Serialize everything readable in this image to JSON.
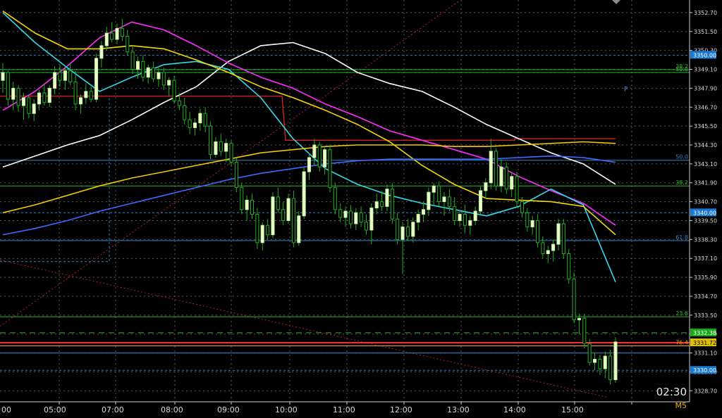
{
  "meta": {
    "timeframe": "M5",
    "countdown": "02:30"
  },
  "chart_data": {
    "type": "candlestick",
    "ylim": [
      3328.0,
      3353.5
    ],
    "y_ticks": [
      "3352.70",
      "3351.50",
      "3350.30",
      "3349.10",
      "3347.90",
      "3346.70",
      "3345.50",
      "3344.30",
      "3343.10",
      "3341.90",
      "3340.70",
      "3339.50",
      "3338.30",
      "3337.10",
      "3335.90",
      "3334.70",
      "3333.50",
      "3332.30",
      "3331.10",
      "3329.90",
      "3328.70"
    ],
    "x_labels": [
      "00",
      "05:00",
      "07:00",
      "08:00",
      "09:00",
      "10:00",
      "11:00",
      "12:00",
      "13:00",
      "14:00",
      "15:00"
    ],
    "candles": [
      [
        3348.4,
        3349.5,
        3347.6,
        3348.9
      ],
      [
        3348.9,
        3349.0,
        3346.8,
        3347.2
      ],
      [
        3347.2,
        3348.3,
        3346.5,
        3347.9
      ],
      [
        3347.9,
        3348.1,
        3346.4,
        3346.8
      ],
      [
        3346.8,
        3347.6,
        3345.9,
        3347.3
      ],
      [
        3347.3,
        3347.5,
        3346.0,
        3346.3
      ],
      [
        3346.3,
        3347.2,
        3345.8,
        3346.9
      ],
      [
        3346.9,
        3347.8,
        3346.5,
        3347.6
      ],
      [
        3347.6,
        3348.2,
        3346.8,
        3347.0
      ],
      [
        3347.0,
        3348.1,
        3346.7,
        3347.9
      ],
      [
        3347.9,
        3349.3,
        3347.5,
        3348.9
      ],
      [
        3348.9,
        3349.4,
        3348.0,
        3348.4
      ],
      [
        3348.4,
        3349.2,
        3347.8,
        3349.0
      ],
      [
        3349.0,
        3349.5,
        3348.1,
        3348.3
      ],
      [
        3348.3,
        3349.0,
        3346.5,
        3346.9
      ],
      [
        3346.9,
        3347.5,
        3346.3,
        3347.3
      ],
      [
        3347.3,
        3348.2,
        3346.9,
        3347.7
      ],
      [
        3347.7,
        3348.0,
        3347.0,
        3347.2
      ],
      [
        3347.2,
        3350.1,
        3347.0,
        3349.8
      ],
      [
        3349.8,
        3350.9,
        3349.2,
        3350.6
      ],
      [
        3350.6,
        3351.8,
        3350.3,
        3351.4
      ],
      [
        3351.4,
        3352.1,
        3350.8,
        3351.0
      ],
      [
        3351.0,
        3352.0,
        3350.7,
        3351.7
      ],
      [
        3351.7,
        3352.3,
        3350.9,
        3351.2
      ],
      [
        3351.2,
        3351.6,
        3350.0,
        3350.2
      ],
      [
        3350.2,
        3350.6,
        3348.8,
        3349.1
      ],
      [
        3349.1,
        3349.9,
        3348.5,
        3349.6
      ],
      [
        3349.6,
        3350.0,
        3348.3,
        3348.6
      ],
      [
        3348.6,
        3349.4,
        3348.2,
        3349.2
      ],
      [
        3349.2,
        3349.6,
        3348.3,
        3348.5
      ],
      [
        3348.5,
        3349.3,
        3348.0,
        3348.9
      ],
      [
        3348.9,
        3349.2,
        3347.8,
        3348.1
      ],
      [
        3348.1,
        3348.6,
        3347.4,
        3348.4
      ],
      [
        3348.4,
        3348.7,
        3346.9,
        3347.1
      ],
      [
        3347.1,
        3347.6,
        3346.5,
        3346.8
      ],
      [
        3346.8,
        3347.3,
        3345.6,
        3345.9
      ],
      [
        3345.9,
        3346.4,
        3345.0,
        3345.4
      ],
      [
        3345.4,
        3346.0,
        3344.9,
        3345.7
      ],
      [
        3345.7,
        3346.6,
        3345.2,
        3346.3
      ],
      [
        3346.3,
        3346.7,
        3345.1,
        3345.5
      ],
      [
        3345.5,
        3345.8,
        3343.4,
        3343.7
      ],
      [
        3343.7,
        3344.8,
        3343.5,
        3344.5
      ],
      [
        3344.5,
        3345.0,
        3343.6,
        3343.9
      ],
      [
        3343.9,
        3344.7,
        3343.2,
        3344.4
      ],
      [
        3344.4,
        3344.6,
        3342.9,
        3343.2
      ],
      [
        3343.2,
        3343.5,
        3341.3,
        3341.6
      ],
      [
        3341.6,
        3341.9,
        3339.9,
        3340.2
      ],
      [
        3340.2,
        3341.1,
        3339.5,
        3340.8
      ],
      [
        3340.8,
        3341.2,
        3339.6,
        3339.9
      ],
      [
        3339.9,
        3340.3,
        3337.7,
        3338.1
      ],
      [
        3338.1,
        3339.4,
        3337.6,
        3339.2
      ],
      [
        3339.2,
        3339.6,
        3338.3,
        3338.6
      ],
      [
        3338.6,
        3341.3,
        3338.4,
        3341.0
      ],
      [
        3341.0,
        3341.6,
        3340.0,
        3340.2
      ],
      [
        3340.2,
        3340.7,
        3339.2,
        3339.5
      ],
      [
        3339.5,
        3341.2,
        3339.3,
        3340.9
      ],
      [
        3340.9,
        3341.4,
        3337.8,
        3338.1
      ],
      [
        3338.1,
        3340.1,
        3337.9,
        3339.8
      ],
      [
        3339.8,
        3342.9,
        3339.6,
        3342.6
      ],
      [
        3342.6,
        3343.8,
        3342.1,
        3343.5
      ],
      [
        3343.5,
        3344.7,
        3343.0,
        3344.3
      ],
      [
        3344.3,
        3344.5,
        3342.6,
        3342.9
      ],
      [
        3342.9,
        3344.2,
        3342.4,
        3344.0
      ],
      [
        3344.0,
        3344.3,
        3341.3,
        3341.6
      ],
      [
        3341.6,
        3341.9,
        3339.9,
        3340.2
      ],
      [
        3340.2,
        3340.6,
        3339.4,
        3339.7
      ],
      [
        3339.7,
        3340.4,
        3339.1,
        3340.1
      ],
      [
        3340.1,
        3340.5,
        3339.0,
        3339.3
      ],
      [
        3339.3,
        3340.3,
        3338.9,
        3340.0
      ],
      [
        3340.0,
        3340.4,
        3339.1,
        3339.4
      ],
      [
        3339.4,
        3339.9,
        3338.6,
        3338.9
      ],
      [
        3338.9,
        3340.6,
        3338.0,
        3340.3
      ],
      [
        3340.3,
        3341.2,
        3339.9,
        3340.7
      ],
      [
        3340.7,
        3341.4,
        3340.1,
        3340.4
      ],
      [
        3340.4,
        3341.8,
        3340.1,
        3341.5
      ],
      [
        3341.5,
        3341.9,
        3339.3,
        3339.6
      ],
      [
        3339.6,
        3340.0,
        3338.0,
        3338.3
      ],
      [
        3338.3,
        3339.4,
        3336.1,
        3339.1
      ],
      [
        3339.1,
        3339.6,
        3338.2,
        3338.5
      ],
      [
        3338.5,
        3339.7,
        3338.1,
        3339.4
      ],
      [
        3339.4,
        3340.2,
        3338.9,
        3339.9
      ],
      [
        3339.9,
        3340.7,
        3339.4,
        3340.2
      ],
      [
        3340.2,
        3341.6,
        3339.8,
        3341.3
      ],
      [
        3341.3,
        3341.9,
        3340.5,
        3341.7
      ],
      [
        3341.7,
        3342.0,
        3340.4,
        3340.7
      ],
      [
        3340.7,
        3341.3,
        3339.8,
        3341.0
      ],
      [
        3341.0,
        3341.5,
        3340.1,
        3340.4
      ],
      [
        3340.4,
        3341.0,
        3339.2,
        3339.5
      ],
      [
        3339.5,
        3340.2,
        3339.1,
        3339.9
      ],
      [
        3339.9,
        3340.5,
        3338.7,
        3339.2
      ],
      [
        3339.2,
        3339.8,
        3338.6,
        3339.5
      ],
      [
        3339.5,
        3340.4,
        3339.2,
        3340.1
      ],
      [
        3340.1,
        3341.7,
        3339.8,
        3341.4
      ],
      [
        3341.4,
        3342.2,
        3340.9,
        3341.9
      ],
      [
        3341.9,
        3344.7,
        3341.5,
        3343.9
      ],
      [
        3343.9,
        3344.1,
        3341.4,
        3341.7
      ],
      [
        3341.7,
        3343.4,
        3341.3,
        3342.9
      ],
      [
        3342.9,
        3343.2,
        3341.2,
        3341.5
      ],
      [
        3341.5,
        3342.6,
        3341.0,
        3342.3
      ],
      [
        3342.3,
        3342.6,
        3340.4,
        3340.7
      ],
      [
        3340.7,
        3341.0,
        3339.7,
        3340.0
      ],
      [
        3340.0,
        3340.3,
        3338.8,
        3339.1
      ],
      [
        3339.1,
        3339.8,
        3338.6,
        3339.5
      ],
      [
        3339.5,
        3339.9,
        3337.8,
        3338.1
      ],
      [
        3338.1,
        3338.5,
        3337.1,
        3337.4
      ],
      [
        3337.4,
        3337.9,
        3336.8,
        3337.6
      ],
      [
        3337.6,
        3338.3,
        3336.9,
        3338.0
      ],
      [
        3338.0,
        3339.6,
        3337.6,
        3339.3
      ],
      [
        3339.3,
        3339.6,
        3337.1,
        3337.4
      ],
      [
        3337.4,
        3337.7,
        3335.5,
        3335.8
      ],
      [
        3335.8,
        3336.2,
        3333.0,
        3333.2
      ],
      [
        3333.2,
        3333.6,
        3332.3,
        3333.3
      ],
      [
        3333.3,
        3333.6,
        3331.4,
        3331.7
      ],
      [
        3331.7,
        3332.0,
        3330.3,
        3330.5
      ],
      [
        3330.5,
        3331.1,
        3330.0,
        3330.7
      ],
      [
        3330.7,
        3331.0,
        3329.7,
        3330.1
      ],
      [
        3330.1,
        3331.2,
        3329.5,
        3330.9
      ],
      [
        3330.9,
        3331.3,
        3329.1,
        3329.4
      ],
      [
        3329.4,
        3332.1,
        3329.2,
        3331.8
      ]
    ],
    "moving_averages": [
      {
        "color": "#ffffff",
        "values": [
          3342.9,
          3343.6,
          3344.3,
          3344.9,
          3345.9,
          3347.0,
          3348.0,
          3349.6,
          3350.6,
          3350.8,
          3350.1,
          3348.9,
          3348.2,
          3347.7,
          3346.7,
          3345.6,
          3344.7,
          3343.8,
          3343.1,
          3341.8
        ]
      },
      {
        "color": "#ff2cff",
        "values": [
          3346.5,
          3347.7,
          3349.3,
          3351.1,
          3352.1,
          3351.6,
          3350.6,
          3349.5,
          3348.6,
          3347.9,
          3346.9,
          3346.1,
          3345.2,
          3344.6,
          3344.0,
          3343.4,
          3342.3,
          3341.4,
          3340.6,
          3339.2
        ]
      },
      {
        "color": "#34d9ea",
        "values": [
          3352.7,
          3350.8,
          3349.2,
          3347.7,
          3348.6,
          3349.4,
          3349.6,
          3349.1,
          3347.3,
          3344.7,
          3342.8,
          3341.8,
          3341.1,
          3340.6,
          3340.2,
          3339.8,
          3340.4,
          3341.5,
          3340.5,
          3335.6
        ]
      },
      {
        "color": "#f5d800",
        "values": [
          3352.8,
          3351.4,
          3350.4,
          3350.4,
          3350.6,
          3350.4,
          3349.7,
          3348.9,
          3348.0,
          3347.3,
          3346.5,
          3345.6,
          3344.5,
          3343.0,
          3341.8,
          3340.9,
          3340.8,
          3340.7,
          3340.4,
          3338.6
        ]
      },
      {
        "color": "#f0c800",
        "values": [
          3340.0,
          3340.5,
          3341.1,
          3341.7,
          3342.2,
          3342.6,
          3343.0,
          3343.4,
          3343.8,
          3344.0,
          3344.2,
          3344.3,
          3344.3,
          3344.3,
          3344.2,
          3344.2,
          3344.3,
          3344.4,
          3344.5,
          3344.4
        ]
      },
      {
        "color": "#3f69ff",
        "values": [
          3338.6,
          3339.0,
          3339.5,
          3340.1,
          3340.6,
          3341.1,
          3341.6,
          3342.1,
          3342.5,
          3342.8,
          3343.1,
          3343.3,
          3343.4,
          3343.4,
          3343.4,
          3343.4,
          3343.5,
          3343.6,
          3343.5,
          3343.2
        ]
      }
    ],
    "horizontal_levels": [
      {
        "price": "3349.08",
        "label": "38.2",
        "color": "#2cb82c",
        "style": "solid"
      },
      {
        "price": "3348.90",
        "label": "50.0",
        "color": "#2cb82c",
        "style": "solid"
      },
      {
        "price": "3350.00",
        "label": "3350.00",
        "color": "#2f86c8",
        "style": "dashed",
        "tag": true,
        "tagColor": "#1a78d0"
      },
      {
        "price": "3343.33",
        "label": "50.0",
        "color": "#2f86c8",
        "style": "solid"
      },
      {
        "price": "3341.70",
        "label": "38.2",
        "color": "#2cb82c",
        "style": "solid"
      },
      {
        "price": "3340.00",
        "label": "3340.00",
        "color": "#2f86c8",
        "style": "dashed",
        "tag": true,
        "tagColor": "#1a78d0"
      },
      {
        "price": "3338.23",
        "label": "61.8",
        "color": "#2f86c8",
        "style": "solid"
      },
      {
        "price": "3333.40",
        "label": "23.6",
        "color": "#2cb82c",
        "style": "solid"
      },
      {
        "price": "3332.38",
        "label": "3332.38",
        "color": "#2cb82c",
        "style": "dashed",
        "tag": true,
        "tagColor": "#18a818"
      },
      {
        "price": "3331.75",
        "label": "3331.72",
        "color": "#ff2a2a",
        "style": "solid",
        "tag": true,
        "tagColor": "#e0c000",
        "tagText": "#000"
      },
      {
        "price": "3331.55",
        "label": "76.4",
        "color": "#ffaa00",
        "style": "solid"
      },
      {
        "price": "3331.10",
        "label": "",
        "color": "#2f86c8",
        "style": "solid"
      },
      {
        "price": "3330.00",
        "label": "3330.00",
        "color": "#2f86c8",
        "style": "dashed",
        "tag": true,
        "tagColor": "#1a78d0"
      }
    ],
    "pivot_label": "P"
  }
}
